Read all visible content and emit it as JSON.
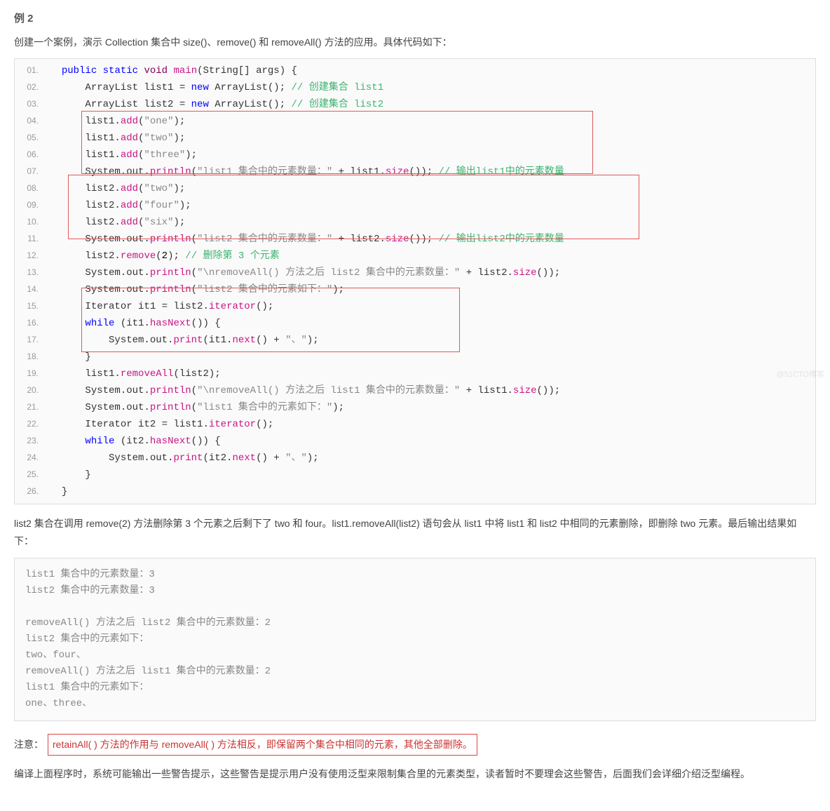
{
  "heading": "例 2",
  "intro": "创建一个案例，演示 Collection 集合中 size()、remove() 和 removeAll() 方法的应用。具体代码如下：",
  "code": {
    "l1": {
      "no": "01.",
      "a": "public",
      "b": "static",
      "c": "void",
      "d": "main",
      "e": "(String[] args) {"
    },
    "l2": {
      "no": "02.",
      "a": "ArrayList list1 = ",
      "b": "new",
      "c": " ArrayList();",
      "d": " // 创建集合 list1"
    },
    "l3": {
      "no": "03.",
      "a": "ArrayList list2 = ",
      "b": "new",
      "c": " ArrayList();",
      "d": " // 创建集合 list2"
    },
    "l4": {
      "no": "04.",
      "a": "list1.",
      "b": "add",
      "c": "(",
      "d": "\"one\"",
      "e": ");"
    },
    "l5": {
      "no": "05.",
      "a": "list1.",
      "b": "add",
      "c": "(",
      "d": "\"two\"",
      "e": ");"
    },
    "l6": {
      "no": "06.",
      "a": "list1.",
      "b": "add",
      "c": "(",
      "d": "\"three\"",
      "e": ");"
    },
    "l7": {
      "no": "07.",
      "a": "System.out.",
      "b": "println",
      "c": "(",
      "d": "\"list1 集合中的元素数量：\"",
      "e": " + list1.",
      "f": "size",
      "g": "());",
      "h": " // 输出list1中的元素数量"
    },
    "l8": {
      "no": "08.",
      "a": "list2.",
      "b": "add",
      "c": "(",
      "d": "\"two\"",
      "e": ");"
    },
    "l9": {
      "no": "09.",
      "a": "list2.",
      "b": "add",
      "c": "(",
      "d": "\"four\"",
      "e": ");"
    },
    "l10": {
      "no": "10.",
      "a": "list2.",
      "b": "add",
      "c": "(",
      "d": "\"six\"",
      "e": ");"
    },
    "l11": {
      "no": "11.",
      "a": "System.out.",
      "b": "println",
      "c": "(",
      "d": "\"list2 集合中的元素数量：\"",
      "e": " + list2.",
      "f": "size",
      "g": "());",
      "h": " // 输出list2中的元素数量"
    },
    "l12": {
      "no": "12.",
      "a": "list2.",
      "b": "remove",
      "c": "(",
      "d": "2",
      "e": ");",
      "f": " // 删除第 3 个元素"
    },
    "l13": {
      "no": "13.",
      "a": "System.out.",
      "b": "println",
      "c": "(",
      "d": "\"\\nremoveAll() 方法之后 list2 集合中的元素数量：\"",
      "e": " + list2.",
      "f": "size",
      "g": "());"
    },
    "l14": {
      "no": "14.",
      "a": "System.out.",
      "b": "println",
      "c": "(",
      "d": "\"list2 集合中的元素如下：\"",
      "e": ");"
    },
    "l15": {
      "no": "15.",
      "a": "Iterator it1 = list2.",
      "b": "iterator",
      "c": "();"
    },
    "l16": {
      "no": "16.",
      "a": "while",
      "b": " (it1.",
      "c": "hasNext",
      "d": "()) {"
    },
    "l17": {
      "no": "17.",
      "a": "System.out.",
      "b": "print",
      "c": "(it1.",
      "d": "next",
      "e": "() + ",
      "f": "\"、\"",
      "g": ");"
    },
    "l18": {
      "no": "18.",
      "a": "}"
    },
    "l19": {
      "no": "19.",
      "a": "list1.",
      "b": "removeAll",
      "c": "(list2);"
    },
    "l20": {
      "no": "20.",
      "a": "System.out.",
      "b": "println",
      "c": "(",
      "d": "\"\\nremoveAll() 方法之后 list1 集合中的元素数量：\"",
      "e": " + list1.",
      "f": "size",
      "g": "());"
    },
    "l21": {
      "no": "21.",
      "a": "System.out.",
      "b": "println",
      "c": "(",
      "d": "\"list1 集合中的元素如下：\"",
      "e": ");"
    },
    "l22": {
      "no": "22.",
      "a": "Iterator it2 = list1.",
      "b": "iterator",
      "c": "();"
    },
    "l23": {
      "no": "23.",
      "a": "while",
      "b": " (it2.",
      "c": "hasNext",
      "d": "()) {"
    },
    "l24": {
      "no": "24.",
      "a": "System.out.",
      "b": "print",
      "c": "(it2.",
      "d": "next",
      "e": "() + ",
      "f": "\"、\"",
      "g": ");"
    },
    "l25": {
      "no": "25.",
      "a": "}"
    },
    "l26": {
      "no": "26.",
      "a": "}"
    }
  },
  "para": "list2 集合在调用 remove(2) 方法删除第 3 个元素之后剩下了 two 和 four。list1.removeAll(list2) 语句会从 list1 中将 list1 和 list2 中相同的元素删除，即删除 two 元素。最后输出结果如下：",
  "output": "list1 集合中的元素数量：3\nlist2 集合中的元素数量：3\n\nremoveAll() 方法之后 list2 集合中的元素数量：2\nlist2 集合中的元素如下：\ntwo、four、\nremoveAll() 方法之后 list1 集合中的元素数量：2\nlist1 集合中的元素如下：\none、three、",
  "note_label": "注意：",
  "note_text": "retainAll( ) 方法的作用与 removeAll( ) 方法相反，即保留两个集合中相同的元素，其他全部删除。",
  "final": "编译上面程序时，系统可能输出一些警告提示，这些警告是提示用户没有使用泛型来限制集合里的元素类型，读者暂时不要理会这些警告，后面我们会详细介绍泛型编程。",
  "watermark": "@51CTO博客"
}
